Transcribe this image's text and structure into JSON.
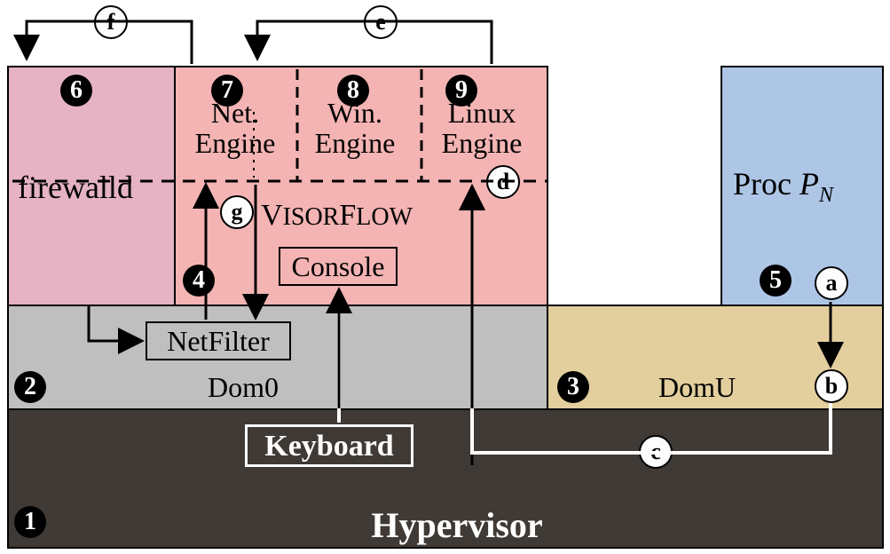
{
  "hypervisor": {
    "label": "Hypervisor",
    "keyboard_label": "Keyboard"
  },
  "dom0": {
    "label": "Dom0",
    "netfilter_label": "NetFilter"
  },
  "domU": {
    "label": "DomU"
  },
  "firewalld": {
    "label": "firewalld"
  },
  "visorflow": {
    "title": "VisorFlow",
    "console_label": "Console",
    "engines": {
      "net": {
        "line1": "Net.",
        "line2": "Engine"
      },
      "win": {
        "line1": "Win.",
        "line2": "Engine"
      },
      "linux": {
        "line1": "Linux",
        "line2": "Engine"
      }
    }
  },
  "proc": {
    "prefix": "Proc ",
    "var": "P",
    "sub": "N"
  },
  "circled_numbers": {
    "n1": "1",
    "n2": "2",
    "n3": "3",
    "n4": "4",
    "n5": "5",
    "n6": "6",
    "n7": "7",
    "n8": "8",
    "n9": "9"
  },
  "circled_letters": {
    "a": "a",
    "b": "b",
    "c": "c",
    "d": "d",
    "e": "e",
    "f": "f",
    "g": "g"
  }
}
